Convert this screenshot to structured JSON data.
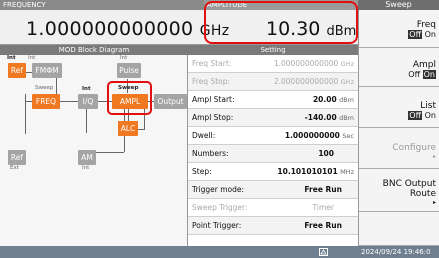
{
  "header": {
    "frequency_label": "FREQUENCY",
    "frequency_value": "1.000000000000",
    "frequency_unit": "GHz",
    "amplitude_label": "AMPLITUDE",
    "amplitude_value": "10.30",
    "amplitude_unit": "dBm"
  },
  "sidebar": {
    "title": "Sweep",
    "keys": [
      {
        "label": "Freq",
        "off": "Off",
        "on": "On",
        "selected": "Off"
      },
      {
        "label": "Ampl",
        "off": "Off",
        "on": "On",
        "selected": "On"
      },
      {
        "label": "List",
        "off": "Off",
        "on": "On",
        "selected": "Off"
      },
      {
        "label": "Configure",
        "sub": "▸"
      },
      {
        "label": "BNC Output",
        "label2": "Route",
        "sub": "▸"
      },
      {
        "label": ""
      }
    ]
  },
  "diagram": {
    "title": "MOD Block Diagram",
    "int_labels": [
      "Int",
      "Int",
      "Int",
      "Int"
    ],
    "ext_labels": [
      "Ext",
      "Int"
    ],
    "sweep_labels": [
      "Sweep",
      "Sweep"
    ],
    "blocks": {
      "ref1": "Ref",
      "fmphim": "FMΦM",
      "pulse": "Pulse",
      "freq": "FREQ",
      "iq": "I/Q",
      "ampl": "AMPL",
      "output": "Output",
      "alc": "ALC",
      "ref2": "Ref",
      "am": "AM"
    }
  },
  "setting": {
    "title": "Setting",
    "rows": [
      {
        "key": "Freq Start:",
        "value": "1.000000000000",
        "unit": "GHz",
        "enabled": false
      },
      {
        "key": "Freq Stop:",
        "value": "2.000000000000",
        "unit": "GHz",
        "enabled": false
      },
      {
        "key": "Ampl Start:",
        "value": "20.00",
        "unit": "dBm",
        "enabled": true
      },
      {
        "key": "Ampl Stop:",
        "value": "-140.00",
        "unit": "dBm",
        "enabled": true
      },
      {
        "key": "Dwell:",
        "value": "1.000000000",
        "unit": "Sec",
        "enabled": true
      },
      {
        "key": "Numbers:",
        "value": "100",
        "unit": "",
        "enabled": true
      },
      {
        "key": "Step:",
        "value": "10.101010101",
        "unit": "MHz",
        "enabled": true
      },
      {
        "key": "Trigger mode:",
        "value": "Free Run",
        "unit": "",
        "enabled": true
      },
      {
        "key": "Sweep Trigger:",
        "value": "Timer",
        "unit": "",
        "enabled": false
      },
      {
        "key": "Point Trigger:",
        "value": "Free Run",
        "unit": "",
        "enabled": true
      }
    ]
  },
  "status": {
    "icon": "network-icon",
    "datetime": "2024/09/24 19:46:0"
  },
  "colors": {
    "active_block": "#f07820",
    "inactive_block": "#a4a4a4",
    "highlight": "#e01010",
    "status_bar": "#6f7f90"
  }
}
